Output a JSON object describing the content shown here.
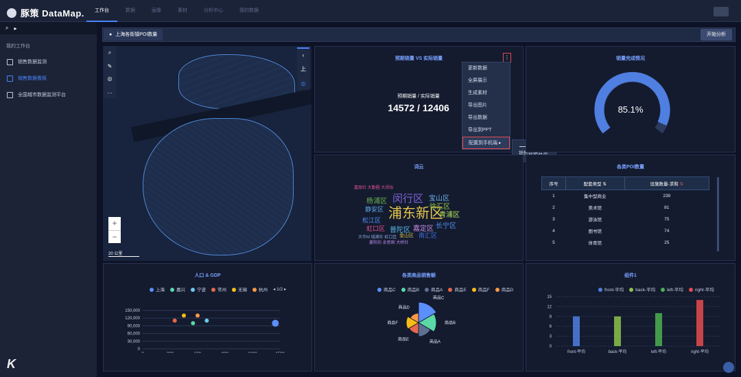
{
  "app": {
    "logo": "豚策 DataMap.",
    "nav": [
      "工作台",
      "数据",
      "画像",
      "素材",
      "分析中心",
      "我的数据"
    ]
  },
  "sidebar": {
    "section": "我的工作台",
    "items": [
      {
        "label": "销售数据监测"
      },
      {
        "label": "销售数据看板"
      },
      {
        "label": "全国城市数据监测平台"
      }
    ]
  },
  "tab": {
    "title": "上海各街镇POI数量",
    "start": "开始分析"
  },
  "map": {
    "zoom_in": "+",
    "zoom_out": "−",
    "scale": "20 公里",
    "side_up": "上"
  },
  "sales": {
    "title": "预期销量 VS 实际销量",
    "label": "预期销量 / 实际销量",
    "value": "14572 / 12406",
    "menu": [
      "更新数据",
      "全屏展示",
      "生成素材",
      "导出图片",
      "导出数据",
      "导出到PPT",
      "配置到手机端"
    ],
    "submenu": "销售数据监测"
  },
  "gauge": {
    "title": "销量完成情况",
    "value": "85.1%",
    "accent": "#4f7fe0"
  },
  "wordcloud_title": "词云",
  "poi": {
    "title": "各类POI数量",
    "headers": [
      "序号",
      "配套类型",
      "设施数量-求和"
    ],
    "rows": [
      [
        "1",
        "集中型商业",
        "239"
      ],
      [
        "2",
        "美术馆",
        "81"
      ],
      [
        "3",
        "游泳馆",
        "75"
      ],
      [
        "4",
        "图书馆",
        "74"
      ],
      [
        "5",
        "体育馆",
        "25"
      ]
    ]
  },
  "pop": {
    "title": "人口 & GDP",
    "legend": [
      "上海",
      "嘉兴",
      "宁波",
      "常州",
      "无锡",
      "杭州"
    ],
    "page": "1/2",
    "yticks": [
      "150,000",
      "120,000",
      "90,000",
      "60,000",
      "30,000",
      "0"
    ],
    "xticks": [
      "0",
      "300",
      "600",
      "900",
      "1200",
      "1500"
    ]
  },
  "rose": {
    "title": "各类商品销售额",
    "legend": [
      "商品C",
      "商品B",
      "商品A",
      "商品E",
      "商品F",
      "商品D"
    ]
  },
  "bars": {
    "title": "组件1",
    "legend": [
      "front-平均",
      "back-平均",
      "left-平均",
      "right-平均"
    ],
    "yticks": [
      "15",
      "12",
      "9",
      "6",
      "3",
      "0"
    ]
  },
  "chart_data": [
    {
      "type": "bar",
      "title": "组件1",
      "categories": [
        "front-平均",
        "back-平均",
        "left-平均",
        "right-平均"
      ],
      "values": [
        9,
        9,
        10,
        14
      ],
      "ylim": [
        0,
        15
      ]
    },
    {
      "type": "scatter",
      "title": "人口 & GDP",
      "series": [
        {
          "name": "上海",
          "values": [
            [
              1450,
              100000
            ]
          ]
        },
        {
          "name": "嘉兴",
          "values": [
            [
              550,
              100000
            ]
          ]
        },
        {
          "name": "宁波",
          "values": [
            [
              700,
              110000
            ]
          ]
        },
        {
          "name": "常州",
          "values": [
            [
              350,
              110000
            ]
          ]
        },
        {
          "name": "无锡",
          "values": [
            [
              450,
              130000
            ]
          ]
        },
        {
          "name": "杭州",
          "values": [
            [
              600,
              130000
            ]
          ]
        }
      ],
      "xlim": [
        0,
        1500
      ],
      "ylim": [
        0,
        150000
      ]
    },
    {
      "type": "pie",
      "title": "各类商品销售额",
      "categories": [
        "商品C",
        "商品B",
        "商品A",
        "商品E",
        "商品F",
        "商品D"
      ]
    }
  ]
}
